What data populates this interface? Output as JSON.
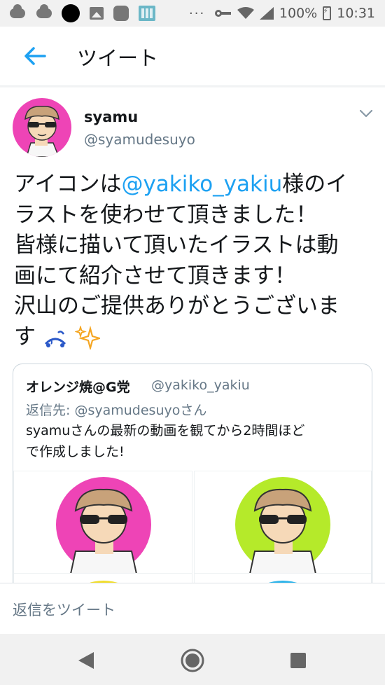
{
  "status_bar": {
    "battery_percent": "100%",
    "time": "10:31",
    "overflow": "···",
    "icons": [
      "cloud-icon",
      "cloud-icon",
      "black-circle-icon",
      "image-icon",
      "app-icon",
      "calculator-icon",
      "key-icon",
      "wifi-icon",
      "signal-icon",
      "battery-charging-icon"
    ]
  },
  "header": {
    "title": "ツイート",
    "back_icon": "arrow-left-icon",
    "accent": "#1da1f2"
  },
  "tweet": {
    "author_name": "syamu",
    "author_handle": "@syamudesuyo",
    "menu_icon": "chevron-down-icon",
    "text_line1_prefix": "アイコンは",
    "mention": "@yakiko_yakiu",
    "text_line1_suffix": "様のイ",
    "text_line2": "ラストを使わせて頂きました！",
    "text_line3": "皆様に描いて頂いたイラストは動",
    "text_line4": "画にて紹介させて頂きます！",
    "text_line5": "沢山のご提供ありがとうございま",
    "text_line6": "す",
    "emojis": [
      "sweat-emoji",
      "sparkles-emoji"
    ]
  },
  "quoted_tweet": {
    "author_name": "オレンジ焼@G党",
    "author_handle": "@yakiko_yakiu",
    "reply_prefix": "返信先: ",
    "reply_handle": "@syamudesuyoさん",
    "text_line1": "syamuさんの最新の動画を観てから2時間ほど",
    "text_line2": "で作成しました!",
    "image_backgrounds": [
      "#ee44b6",
      "#b5ea2a",
      "#f1dd2e",
      "#2fb4ea"
    ]
  },
  "reply_bar": {
    "placeholder": "返信をツイート"
  },
  "nav_bar": {
    "icons": [
      "nav-back-icon",
      "nav-home-icon",
      "nav-recents-icon"
    ]
  },
  "colors": {
    "link": "#1da1f2",
    "secondary_text": "#657786",
    "primary_text": "#14171a"
  }
}
